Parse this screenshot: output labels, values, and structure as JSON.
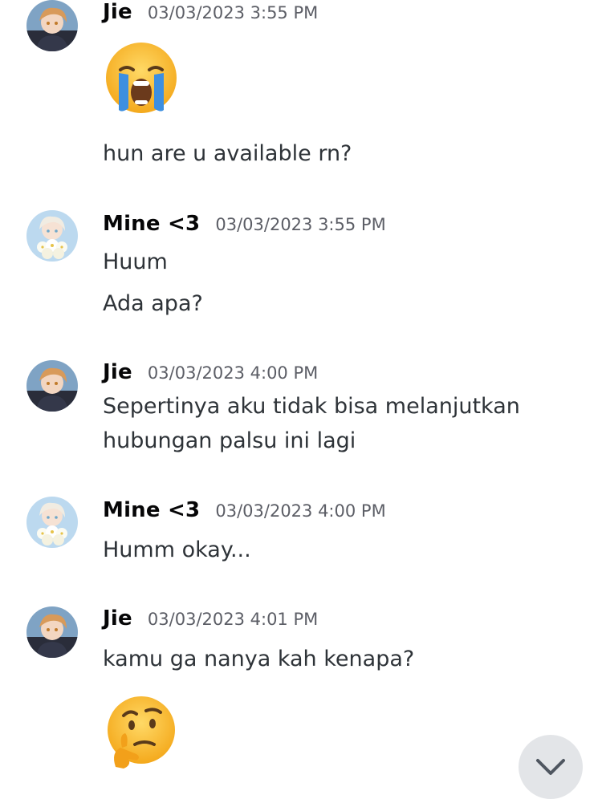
{
  "messages": [
    {
      "author": "Jie",
      "timestamp": "03/03/2023 3:55 PM",
      "lines": [
        "hun are u available rn?"
      ]
    },
    {
      "author": "Mine <3",
      "timestamp": "03/03/2023 3:55 PM",
      "lines": [
        "Huum",
        "Ada apa?"
      ]
    },
    {
      "author": "Jie",
      "timestamp": "03/03/2023 4:00 PM",
      "lines": [
        "Sepertinya aku tidak bisa melanjutkan",
        "hubungan palsu ini lagi"
      ]
    },
    {
      "author": "Mine <3",
      "timestamp": "03/03/2023 4:00 PM",
      "lines": [
        "Humm okay..."
      ]
    },
    {
      "author": "Jie",
      "timestamp": "03/03/2023 4:01 PM",
      "lines": [
        "kamu ga nanya kah kenapa?"
      ]
    }
  ],
  "emojis": [
    "loudly-crying-face",
    "thinking-face"
  ],
  "scroll_button_icon": "chevron-down-icon",
  "colors": {
    "background": "#ffffff",
    "username": "#060607",
    "timestamp": "#5c5e66",
    "message_text": "#2e3338",
    "scroll_button": "#e3e5e8"
  }
}
